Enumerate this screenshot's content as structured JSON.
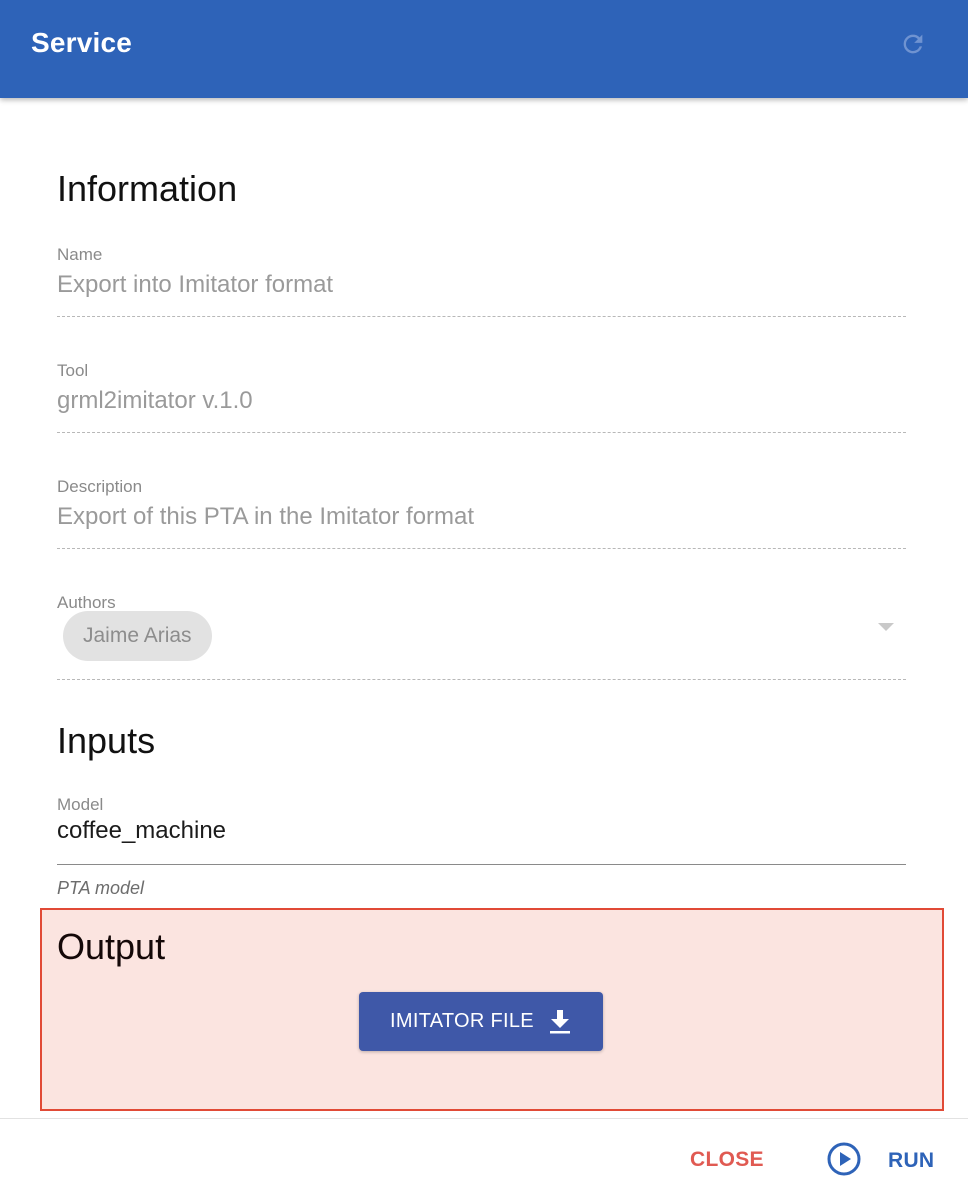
{
  "appbar": {
    "title": "Service",
    "refresh_icon": "refresh-icon",
    "color": "#2e63b8"
  },
  "information": {
    "heading": "Information",
    "name": {
      "label": "Name",
      "value": "Export into Imitator format"
    },
    "tool": {
      "label": "Tool",
      "value": "grml2imitator v.1.0"
    },
    "description": {
      "label": "Description",
      "value": "Export of this PTA in the Imitator format"
    },
    "authors": {
      "label": "Authors",
      "chips": [
        "Jaime Arias"
      ]
    }
  },
  "inputs": {
    "heading": "Inputs",
    "model": {
      "label": "Model",
      "value": "coffee_machine",
      "helper": "PTA model"
    }
  },
  "output": {
    "heading": "Output",
    "download_label": "IMITATOR FILE",
    "download_icon": "download-icon",
    "highlight_color": "#e14a36"
  },
  "actions": {
    "close_label": "CLOSE",
    "run_label": "RUN",
    "run_icon": "play-circle-icon"
  }
}
